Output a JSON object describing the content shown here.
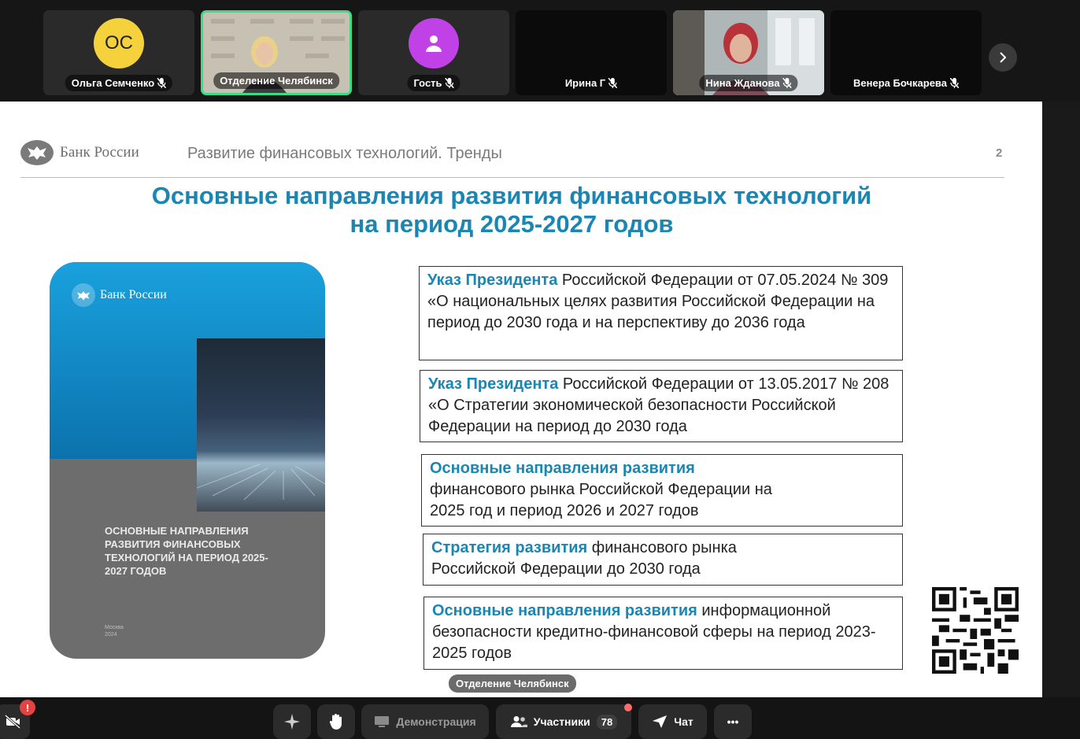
{
  "participants": [
    {
      "name": "Ольга Семченко",
      "initials": "ОС",
      "avatar_color": "#f5d23c",
      "muted": true
    },
    {
      "name": "Отделение Челябинск",
      "active": true,
      "muted": false
    },
    {
      "name": "Гость",
      "avatar_color": "#c042e6",
      "muted": true
    },
    {
      "name": "Ирина Г",
      "muted": true
    },
    {
      "name": "Нина Жданова",
      "muted": true
    },
    {
      "name": "Венера Бочкарева",
      "muted": true
    }
  ],
  "slide": {
    "logo_text": "Банк России",
    "subtitle": "Развитие финансовых технологий. Тренды",
    "page_number": "2",
    "title_line1": "Основные направления развития финансовых технологий",
    "title_line2": "на период 2025-2027 годов",
    "cover": {
      "logo_text": "Банк России",
      "title": "ОСНОВНЫЕ НАПРАВЛЕНИЯ РАЗВИТИЯ ФИНАНСОВЫХ ТЕХНОЛОГИЙ НА ПЕРИОД 2025-2027 ГОДОВ",
      "city": "Москва",
      "year": "2024"
    },
    "boxes": [
      {
        "highlight": "Указ Президента",
        "text": " Российской Федерации от 07.05.2024 № 309 «О национальных целях развития Российской Федерации на период до 2030 года и на перспективу до 2036 года"
      },
      {
        "highlight": "Указ Президента",
        "text": " Российской Федерации от 13.05.2017 № 208 «О Стратегии экономической безопасности Российской Федерации на период до 2030 года"
      },
      {
        "highlight": "Основные направления развития",
        "text": " финансового рынка Российской Федерации на 2025 год и период 2026 и 2027 годов"
      },
      {
        "highlight": "Стратегия развития",
        "text": " финансового рынка Российской Федерации до 2030 года"
      },
      {
        "highlight": "Основные направления развития",
        "text": " информационной безопасности кредитно-финансовой сферы на период 2023-2025 годов"
      }
    ]
  },
  "speaker_label": "Отделение Челябинск",
  "alert_badge": "!",
  "toolbar": {
    "demo_label": "Демонстрация",
    "participants_label": "Участники",
    "participants_count": "78",
    "chat_label": "Чат",
    "more_label": "•••"
  }
}
